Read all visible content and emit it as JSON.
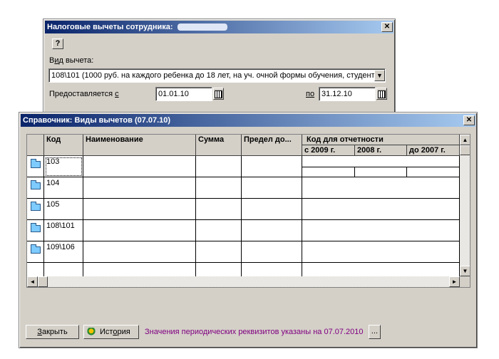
{
  "back_dialog": {
    "title": "Налоговые вычеты сотрудника:",
    "help_glyph": "?",
    "deduction_type_label_pre": "В",
    "deduction_type_label_u": "и",
    "deduction_type_label_post": "д вычета:",
    "deduction_type_value": "108\\101 (1000 руб. на каждого ребенка до 18 лет, на уч. очной формы обучения, студент",
    "provided_from_label_pre": "Предоставляется ",
    "provided_from_label_u": "с",
    "date_from": "01.01.10",
    "to_label": "по",
    "date_to": "31.12.10"
  },
  "front_dialog": {
    "title": "Справочник: Виды вычетов (07.07.10)",
    "columns": {
      "code": "Код",
      "name": "Наименование",
      "sum": "Сумма",
      "limit": "Предел до...",
      "report_code": "Код для отчетности",
      "report_2009": "с 2009 г.",
      "report_2008": "2008 г.",
      "report_2007": "до 2007 г."
    },
    "rows": [
      {
        "code": "103"
      },
      {
        "code": "104"
      },
      {
        "code": "105"
      },
      {
        "code": "108\\101"
      },
      {
        "code": "109\\106"
      },
      {
        "code": ""
      }
    ],
    "close_button_pre": "",
    "close_button_u": "З",
    "close_button_post": "акрыть",
    "history_button_pre": "Ист",
    "history_button_u": "о",
    "history_button_post": "рия",
    "status_text": "Значения периодических реквизитов указаны на 07.07.2010",
    "more_button": "..."
  },
  "colors": {
    "title_start": "#0a246a",
    "title_end": "#a6caf0",
    "status_text": "#800080",
    "selection": "#0a246a"
  }
}
